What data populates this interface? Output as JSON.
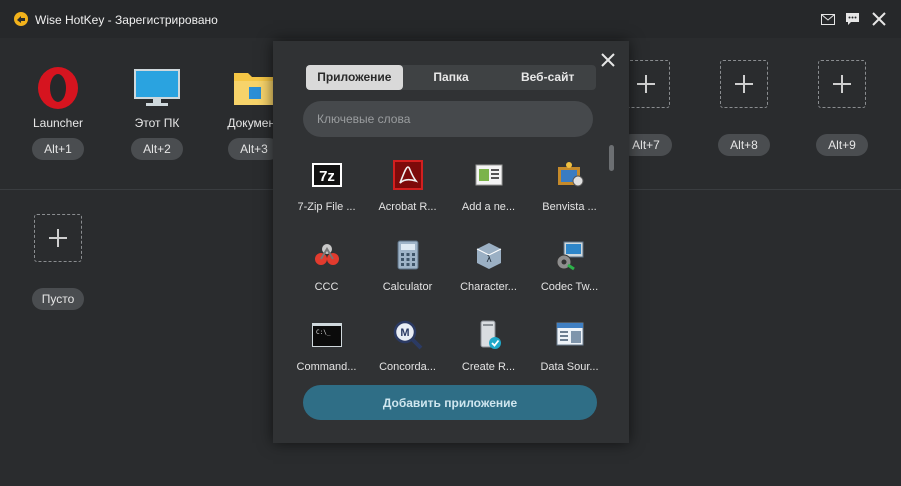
{
  "window": {
    "title": "Wise HotKey - Зарегистрировано",
    "icons": [
      "mail-icon",
      "feedback-icon",
      "close-icon"
    ]
  },
  "slots_row1": [
    {
      "label": "Launcher",
      "hotkey": "Alt+1",
      "icon": "opera-icon"
    },
    {
      "label": "Этот ПК",
      "hotkey": "Alt+2",
      "icon": "monitor-icon"
    },
    {
      "label": "Документ",
      "hotkey": "Alt+3",
      "icon": "folder-icon"
    },
    {
      "label": "",
      "hotkey": "Alt+7",
      "icon": "plus-icon"
    },
    {
      "label": "",
      "hotkey": "Alt+8",
      "icon": "plus-icon"
    },
    {
      "label": "",
      "hotkey": "Alt+9",
      "icon": "plus-icon"
    }
  ],
  "slots_row2": [
    {
      "label": "",
      "hotkey": "Пусто",
      "icon": "plus-icon"
    }
  ],
  "popup": {
    "tabs": [
      {
        "label": "Приложение",
        "active": true
      },
      {
        "label": "Папка",
        "active": false
      },
      {
        "label": "Веб-сайт",
        "active": false
      }
    ],
    "search_placeholder": "Ключевые слова",
    "apps": [
      {
        "name": "7-Zip File ...",
        "icon": "7zip-icon"
      },
      {
        "name": "Acrobat R...",
        "icon": "acrobat-icon"
      },
      {
        "name": "Add a ne...",
        "icon": "add-network-icon"
      },
      {
        "name": "Benvista ...",
        "icon": "benvista-icon"
      },
      {
        "name": "CCC",
        "icon": "ccc-icon"
      },
      {
        "name": "Calculator",
        "icon": "calculator-icon"
      },
      {
        "name": "Character...",
        "icon": "character-map-icon"
      },
      {
        "name": "Codec Tw...",
        "icon": "codec-tweak-icon"
      },
      {
        "name": "Command...",
        "icon": "command-prompt-icon"
      },
      {
        "name": "Concorda...",
        "icon": "concordance-icon"
      },
      {
        "name": "Create R...",
        "icon": "create-recovery-icon"
      },
      {
        "name": "Data Sour...",
        "icon": "data-sources-icon"
      }
    ],
    "add_button": "Добавить приложение"
  }
}
